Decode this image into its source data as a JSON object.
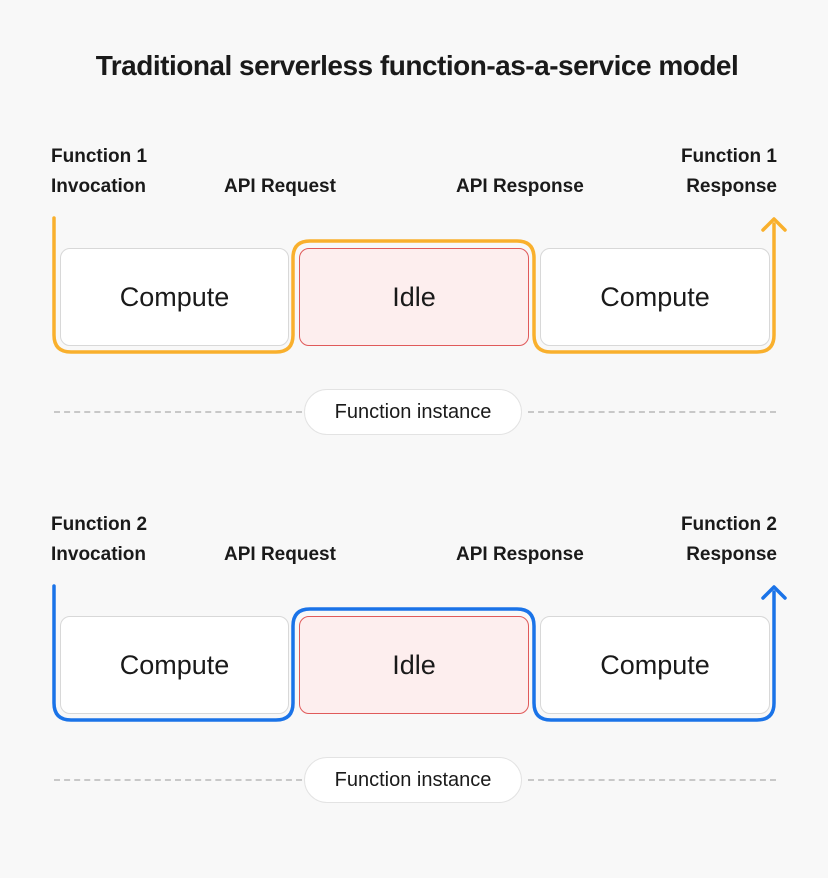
{
  "title": "Traditional serverless function-as-a-service model",
  "sections": [
    {
      "accent_color": "#f9b02d",
      "invocation_line1": "Function 1",
      "invocation_line2": "Invocation",
      "api_request": "API Request",
      "api_response": "API Response",
      "response_line1": "Function 1",
      "response_line2": "Response",
      "boxes": [
        "Compute",
        "Idle",
        "Compute"
      ],
      "instance_label": "Function instance"
    },
    {
      "accent_color": "#1a73e8",
      "invocation_line1": "Function 2",
      "invocation_line2": "Invocation",
      "api_request": "API Request",
      "api_response": "API Response",
      "response_line1": "Function 2",
      "response_line2": "Response",
      "boxes": [
        "Compute",
        "Idle",
        "Compute"
      ],
      "instance_label": "Function instance"
    }
  ]
}
